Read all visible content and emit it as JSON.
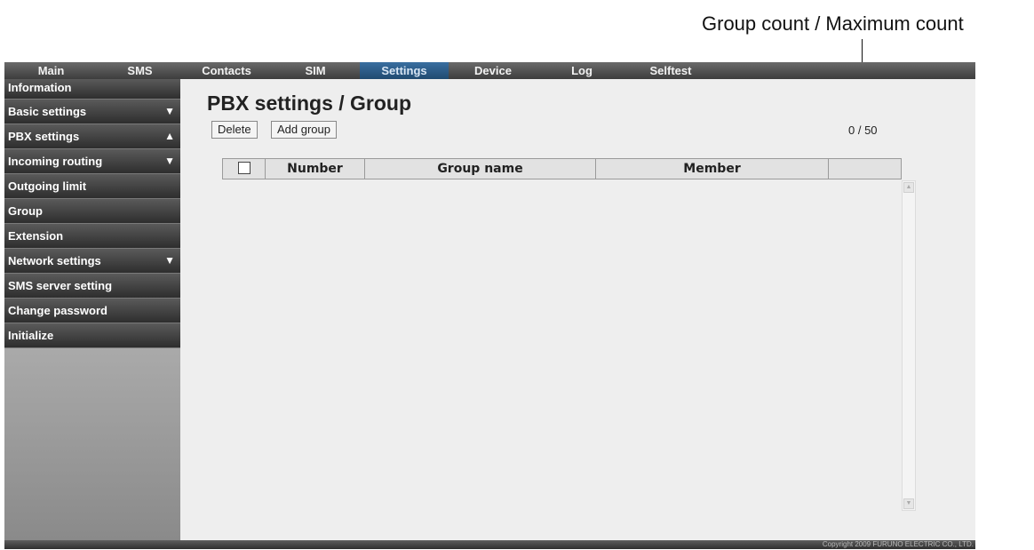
{
  "annotation": {
    "callout": "Group count / Maximum count"
  },
  "nav": [
    {
      "label": "Main",
      "active": false
    },
    {
      "label": "SMS",
      "active": false
    },
    {
      "label": "Contacts",
      "active": false
    },
    {
      "label": "SIM",
      "active": false
    },
    {
      "label": "Settings",
      "active": true
    },
    {
      "label": "Device",
      "active": false
    },
    {
      "label": "Log",
      "active": false
    },
    {
      "label": "Selftest",
      "active": false
    }
  ],
  "sidebar": {
    "items": [
      {
        "label": "Information",
        "arrow": ""
      },
      {
        "label": "Basic settings",
        "arrow": "▼"
      },
      {
        "label": "PBX settings",
        "arrow": "▲"
      },
      {
        "label": "Incoming routing",
        "arrow": "▼"
      },
      {
        "label": "Outgoing limit",
        "arrow": ""
      },
      {
        "label": "Group",
        "arrow": ""
      },
      {
        "label": "Extension",
        "arrow": ""
      },
      {
        "label": "Network settings",
        "arrow": "▼"
      },
      {
        "label": "SMS server setting",
        "arrow": ""
      },
      {
        "label": "Change password",
        "arrow": ""
      },
      {
        "label": "Initialize",
        "arrow": ""
      }
    ]
  },
  "main": {
    "title": "PBX settings / Group",
    "delete_label": "Delete",
    "add_label": "Add group",
    "count": "0 / 50",
    "table": {
      "headers": [
        "",
        "Number",
        "Group name",
        "Member",
        ""
      ]
    }
  },
  "footer": {
    "copyright": "Copyright 2009 FURUNO ELECTRIC CO., LTD."
  },
  "colors": {
    "active_tab": "#2f5f8c",
    "sidebar_item": "#3a3a3a",
    "content_bg": "#eeeeee"
  }
}
